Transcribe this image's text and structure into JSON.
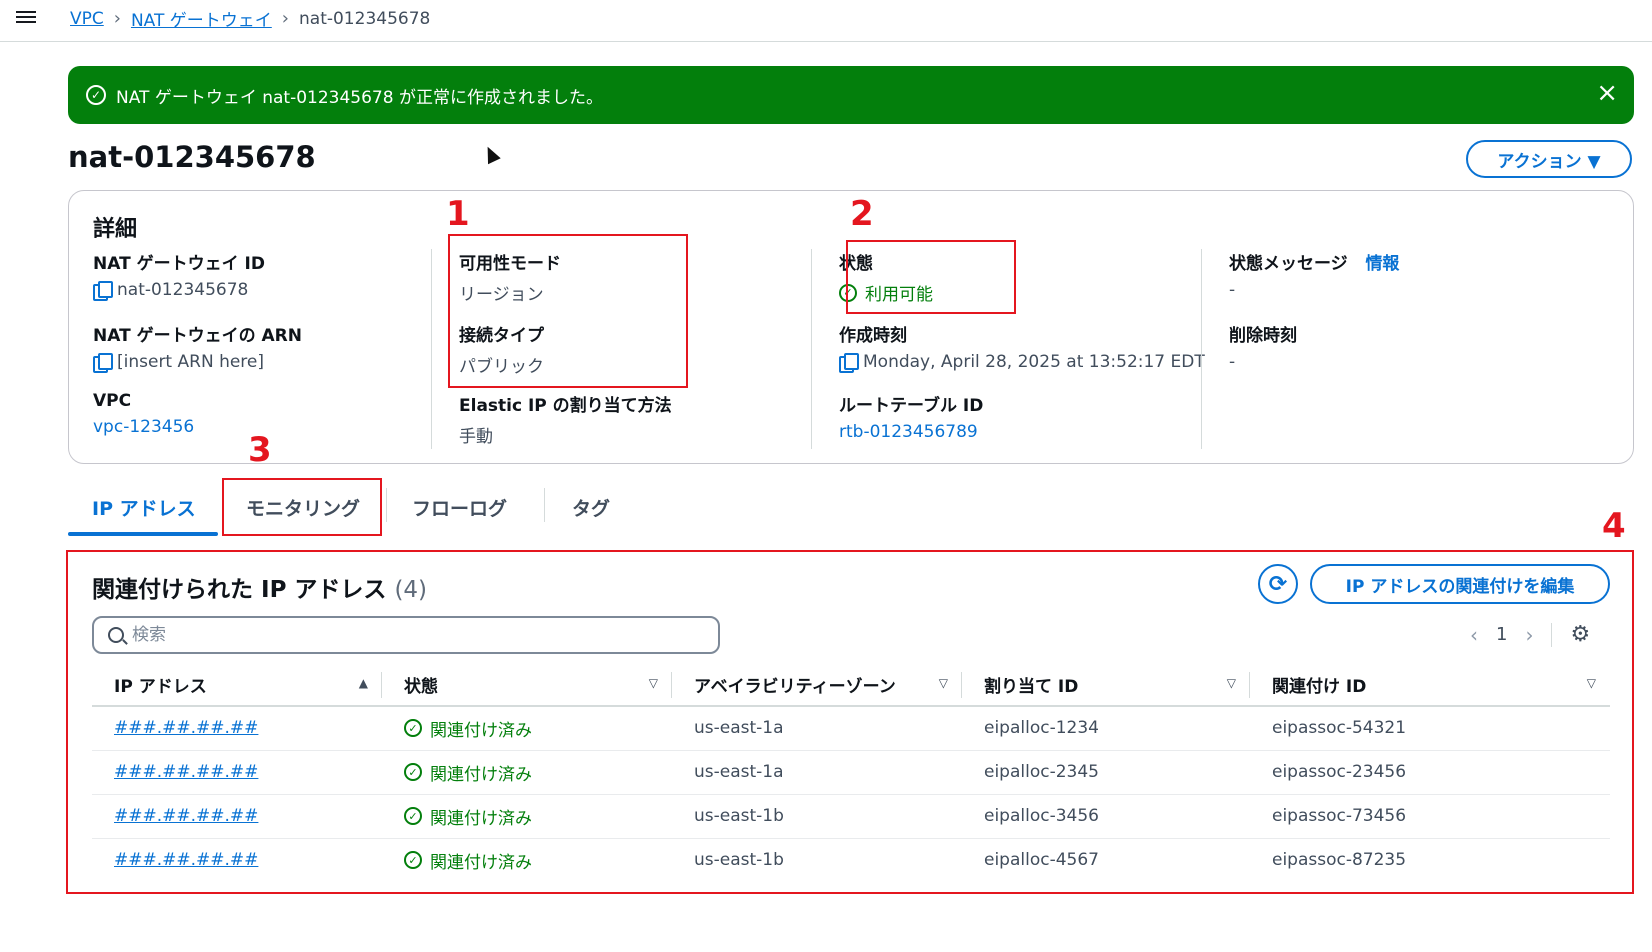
{
  "breadcrumb": {
    "items": [
      "VPC",
      "NAT ゲートウェイ"
    ],
    "current": "nat-012345678"
  },
  "flash": {
    "message": "NAT ゲートウェイ nat-012345678 が正常に作成されました。",
    "close_icon": "×"
  },
  "page": {
    "title": "nat-012345678",
    "actions_label": "アクション ▼"
  },
  "details": {
    "heading": "詳細",
    "nat_id_label": "NAT ゲートウェイ ID",
    "nat_id_value": "nat-012345678",
    "arn_label": "NAT ゲートウェイの ARN",
    "arn_value": "[insert ARN here]",
    "vpc_label": "VPC",
    "vpc_value": "vpc-123456",
    "availability_label": "可用性モード",
    "availability_value": "リージョン",
    "connectivity_label": "接続タイプ",
    "connectivity_value": "パブリック",
    "eip_method_label": "Elastic IP の割り当て方法",
    "eip_method_value": "手動",
    "state_label": "状態",
    "state_value": "利用可能",
    "created_label": "作成時刻",
    "created_value": "Monday, April 28, 2025 at 13:52:17 EDT",
    "route_table_label": "ルートテーブル ID",
    "route_table_value": "rtb-0123456789",
    "state_message_label": "状態メッセージ",
    "state_message_info": "情報",
    "state_message_value": "-",
    "deleted_label": "削除時刻",
    "deleted_value": "-"
  },
  "annotations": [
    "1",
    "2",
    "3",
    "4"
  ],
  "tabs": [
    "IP アドレス",
    "モニタリング",
    "フローログ",
    "タグ"
  ],
  "ip_panel": {
    "title": "関連付けられた IP アドレス",
    "count": "(4)",
    "edit_button": "IP アドレスの関連付けを編集",
    "refresh_icon": "refresh-icon",
    "search_placeholder": "検索",
    "page": "1",
    "columns": [
      "IP アドレス",
      "状態",
      "アベイラビリティーゾーン",
      "割り当て ID",
      "関連付け ID"
    ],
    "rows": [
      {
        "ip": "###.##.##.##",
        "status": "関連付け済み",
        "az": "us-east-1a",
        "alloc": "eipalloc-1234",
        "assoc": "eipassoc-54321"
      },
      {
        "ip": "###.##.##.##",
        "status": "関連付け済み",
        "az": "us-east-1a",
        "alloc": "eipalloc-2345",
        "assoc": "eipassoc-23456"
      },
      {
        "ip": "###.##.##.##",
        "status": "関連付け済み",
        "az": "us-east-1b",
        "alloc": "eipalloc-3456",
        "assoc": "eipassoc-73456"
      },
      {
        "ip": "###.##.##.##",
        "status": "関連付け済み",
        "az": "us-east-1b",
        "alloc": "eipalloc-4567",
        "assoc": "eipassoc-87235"
      }
    ]
  },
  "colors": {
    "accent": "#0972d3",
    "success": "#037f0c",
    "annotation": "#e4161f"
  }
}
